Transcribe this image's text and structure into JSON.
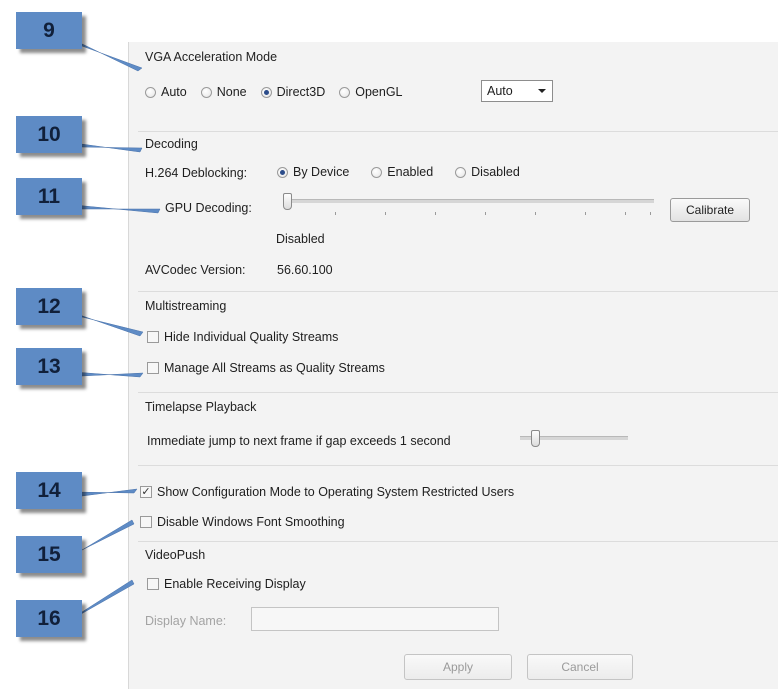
{
  "callouts": [
    "9",
    "10",
    "11",
    "12",
    "13",
    "14",
    "15",
    "16"
  ],
  "vga": {
    "title": "VGA Acceleration Mode",
    "options": [
      {
        "label": "Auto",
        "selected": false
      },
      {
        "label": "None",
        "selected": false
      },
      {
        "label": "Direct3D",
        "selected": true
      },
      {
        "label": "OpenGL",
        "selected": false
      }
    ],
    "dropdown_value": "Auto"
  },
  "decoding": {
    "title": "Decoding",
    "deblocking_label": "H.264 Deblocking:",
    "deblocking_options": [
      {
        "label": "By Device",
        "selected": true
      },
      {
        "label": "Enabled",
        "selected": false
      },
      {
        "label": "Disabled",
        "selected": false
      }
    ],
    "gpu_label": "GPU Decoding:",
    "gpu_level": 0,
    "gpu_value_text": "Disabled",
    "calibrate_label": "Calibrate",
    "avcodec_label": "AVCodec Version:",
    "avcodec_version": "56.60.100"
  },
  "multistreaming": {
    "title": "Multistreaming",
    "hide_label": "Hide Individual Quality Streams",
    "hide_checked": false,
    "manage_label": "Manage All Streams as Quality Streams",
    "manage_checked": false
  },
  "timelapse": {
    "title": "Timelapse Playback",
    "jump_label": "Immediate jump to next frame if gap exceeds 1 second",
    "slider_level": 0.1
  },
  "show_config": {
    "label": "Show Configuration Mode to Operating System Restricted Users",
    "checked": true,
    "mark": "✓"
  },
  "disable_font": {
    "label": "Disable Windows Font Smoothing",
    "checked": false
  },
  "videopush": {
    "title": "VideoPush",
    "enable_label": "Enable Receiving Display",
    "enable_checked": false,
    "display_name_label": "Display Name:",
    "display_name_value": ""
  },
  "footer": {
    "apply_label": "Apply",
    "cancel_label": "Cancel"
  },
  "colors": {
    "callout": "#5e8bc5",
    "callout_text": "#11203a",
    "panel": "#f3f3f3",
    "radio_dot": "#2b4c8a"
  }
}
